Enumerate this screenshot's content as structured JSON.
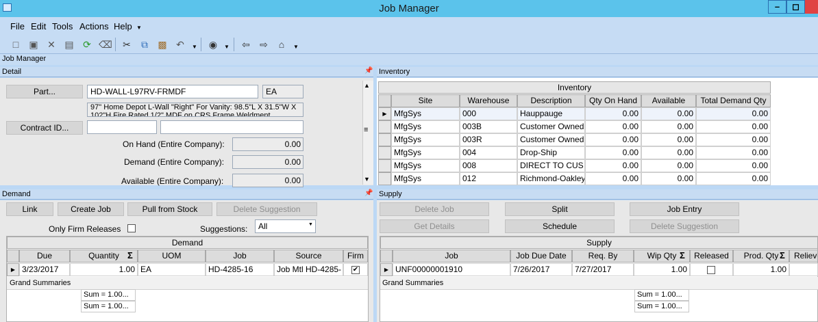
{
  "window": {
    "title": "Job Manager"
  },
  "menu": [
    "File",
    "Edit",
    "Tools",
    "Actions",
    "Help"
  ],
  "strip_title": "Job Manager",
  "detail": {
    "header": "Detail",
    "part_button": "Part...",
    "part_value": "HD-WALL-L97RV-FRMDF",
    "uom": "EA",
    "description": "97\" Home Depot L-Wall \"Right\" For Vanity:  98.5\"L X 31.5\"W X 102\"H Fire Rated 1/2\" MDF on CRS Frame Weldment",
    "contract_button": "Contract ID...",
    "on_hand_label": "On Hand (Entire Company):",
    "on_hand_value": "0.00",
    "demand_label": "Demand (Entire Company):",
    "demand_value": "0.00",
    "available_label": "Available (Entire Company):",
    "available_value": "0.00"
  },
  "inventory": {
    "header": "Inventory",
    "grid_title": "Inventory",
    "columns": [
      "Site",
      "Warehouse",
      "Description",
      "Qty On Hand",
      "Available",
      "Total Demand Qty"
    ],
    "rows": [
      [
        "MfgSys",
        "000",
        "Hauppauge",
        "0.00",
        "0.00",
        "0.00"
      ],
      [
        "MfgSys",
        "003B",
        "Customer Owned",
        "0.00",
        "0.00",
        "0.00"
      ],
      [
        "MfgSys",
        "003R",
        "Customer Owned",
        "0.00",
        "0.00",
        "0.00"
      ],
      [
        "MfgSys",
        "004",
        "Drop-Ship",
        "0.00",
        "0.00",
        "0.00"
      ],
      [
        "MfgSys",
        "008",
        "DIRECT TO CUS",
        "0.00",
        "0.00",
        "0.00"
      ],
      [
        "MfgSys",
        "012",
        "Richmond-Oakley",
        "0.00",
        "0.00",
        "0.00"
      ]
    ]
  },
  "demand": {
    "header": "Demand",
    "buttons": {
      "link": "Link",
      "create_job": "Create Job",
      "pull_from_stock": "Pull from Stock",
      "delete_suggestion": "Delete Suggestion"
    },
    "only_firm_label": "Only Firm Releases",
    "suggestions_label": "Suggestions:",
    "suggestions_value": "All",
    "grid_title": "Demand",
    "columns": [
      "Due",
      "Quantity",
      "UOM",
      "Job",
      "Source",
      "Firm"
    ],
    "row": {
      "due": "3/23/2017",
      "quantity": "1.00",
      "uom": "EA",
      "job": "HD-4285-16",
      "source": "Job Mtl HD-4285-"
    },
    "grand_summaries": "Grand Summaries",
    "sums": [
      "Sum = 1.00...",
      "Sum = 1.00..."
    ]
  },
  "supply": {
    "header": "Supply",
    "buttons": {
      "delete_job": "Delete Job",
      "split": "Split",
      "job_entry": "Job Entry",
      "get_details": "Get Details",
      "schedule": "Schedule",
      "delete_suggestion": "Delete Suggestion"
    },
    "grid_title": "Supply",
    "columns": [
      "Job",
      "Job Due Date",
      "Req. By",
      "Wip Qty",
      "Released",
      "Prod. Qty",
      "Relieve"
    ],
    "row": {
      "job": "UNF00000001910",
      "job_due_date": "7/26/2017",
      "req_by": "7/27/2017",
      "wip_qty": "1.00",
      "prod_qty": "1.00"
    },
    "grand_summaries": "Grand Summaries",
    "sums": [
      "Sum = 1.00...",
      "Sum = 1.00..."
    ]
  }
}
